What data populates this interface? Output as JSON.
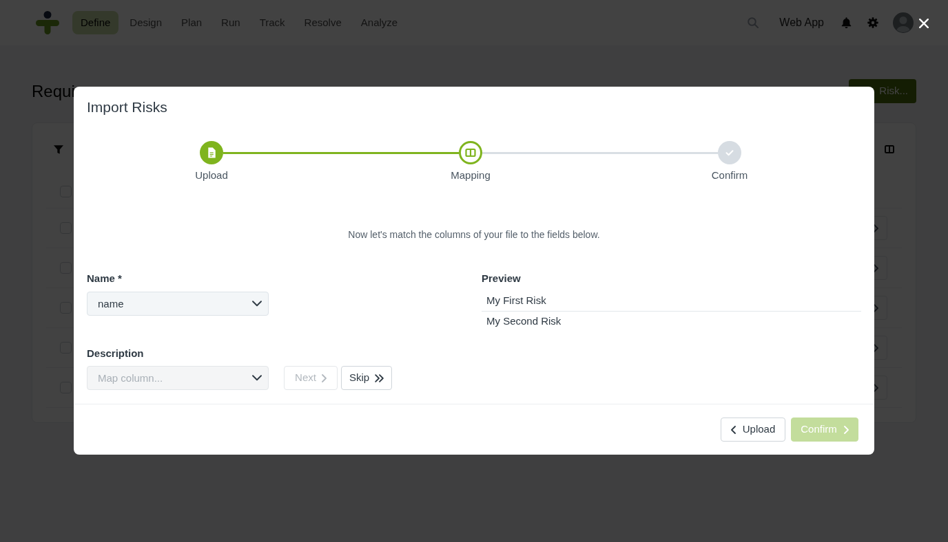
{
  "nav": {
    "items": [
      {
        "label": "Define",
        "selected": true
      },
      {
        "label": "Design",
        "selected": false
      },
      {
        "label": "Plan",
        "selected": false
      },
      {
        "label": "Run",
        "selected": false
      },
      {
        "label": "Track",
        "selected": false
      },
      {
        "label": "Resolve",
        "selected": false
      },
      {
        "label": "Analyze",
        "selected": false
      }
    ],
    "app_label": "Web App"
  },
  "page": {
    "title": "Requi",
    "add_button": "Risk...",
    "select_all": {
      "checked": false
    },
    "rows": [
      {
        "checked": false
      },
      {
        "checked": false
      },
      {
        "checked": false
      },
      {
        "checked": false
      },
      {
        "checked": false
      }
    ]
  },
  "modal": {
    "title": "Import Risks",
    "steps": [
      {
        "label": "Upload",
        "completed": true,
        "selected": false
      },
      {
        "label": "Mapping",
        "completed": false,
        "selected": true
      },
      {
        "label": "Confirm",
        "completed": false,
        "selected": false
      }
    ],
    "instruction": "Now let's match the columns of your file to the fields below.",
    "fields": [
      {
        "label": "Name *",
        "value": "name"
      },
      {
        "label": "Description",
        "placeholder": "Map column...",
        "buttons": [
          {
            "label": "Next",
            "kind": "next",
            "disabled": true
          },
          {
            "label": "Skip",
            "kind": "skip",
            "disabled": false
          }
        ]
      }
    ],
    "preview": {
      "title": "Preview",
      "rows": [
        "My First Risk",
        "My Second Risk"
      ]
    },
    "footer_buttons": [
      {
        "label": "Upload",
        "kind": "back",
        "disabled": false
      },
      {
        "label": "Confirm",
        "kind": "next",
        "disabled": true
      }
    ]
  }
}
